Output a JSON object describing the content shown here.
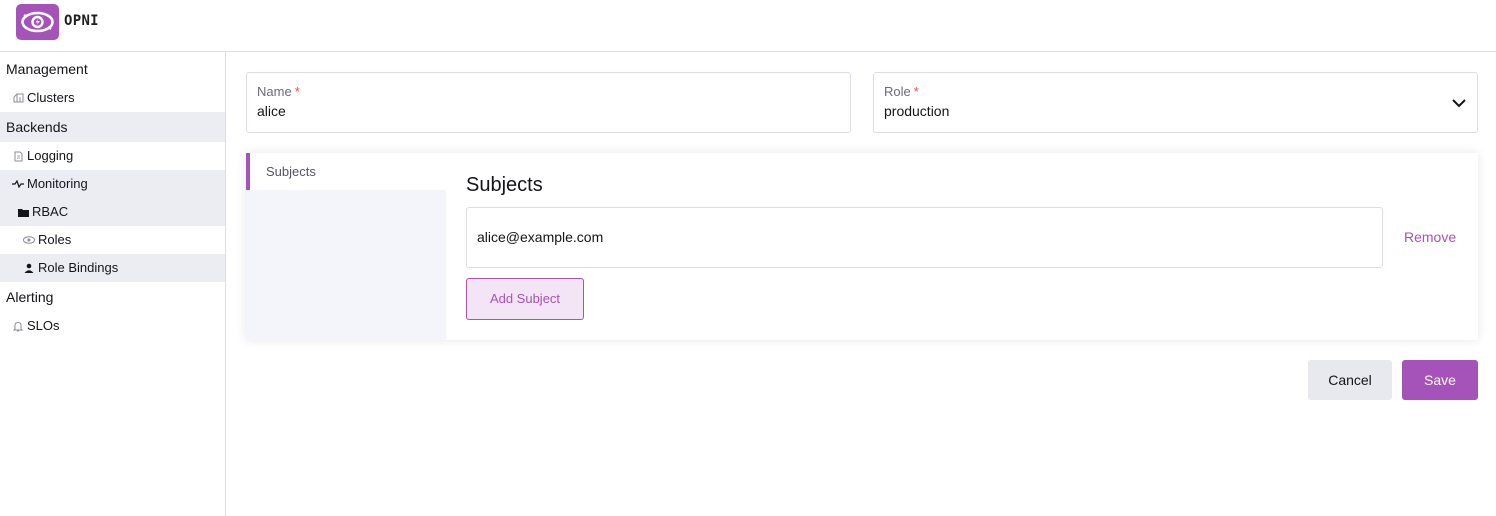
{
  "app": {
    "brand": "OPNI",
    "accent_color": "#a653b9"
  },
  "sidebar": {
    "groups": [
      {
        "label": "Management",
        "items": [
          {
            "label": "Clusters",
            "icon": "cluster-icon"
          }
        ]
      },
      {
        "label": "Backends",
        "items": [
          {
            "label": "Logging",
            "icon": "file-icon"
          },
          {
            "label": "Monitoring",
            "icon": "activity-icon"
          },
          {
            "label": "RBAC",
            "icon": "folder-icon",
            "children": [
              {
                "label": "Roles",
                "icon": "eye-icon"
              },
              {
                "label": "Role Bindings",
                "icon": "user-icon",
                "active": true
              }
            ]
          }
        ]
      },
      {
        "label": "Alerting",
        "items": [
          {
            "label": "SLOs",
            "icon": "bell-icon"
          }
        ]
      }
    ]
  },
  "form": {
    "name": {
      "label": "Name",
      "required_mark": "*",
      "value": "alice"
    },
    "role": {
      "label": "Role",
      "required_mark": "*",
      "value": "production"
    }
  },
  "panel": {
    "tab_label": "Subjects",
    "title": "Subjects",
    "subjects": [
      {
        "value": "alice@example.com",
        "remove_label": "Remove"
      }
    ],
    "add_label": "Add Subject"
  },
  "actions": {
    "cancel_label": "Cancel",
    "save_label": "Save"
  }
}
